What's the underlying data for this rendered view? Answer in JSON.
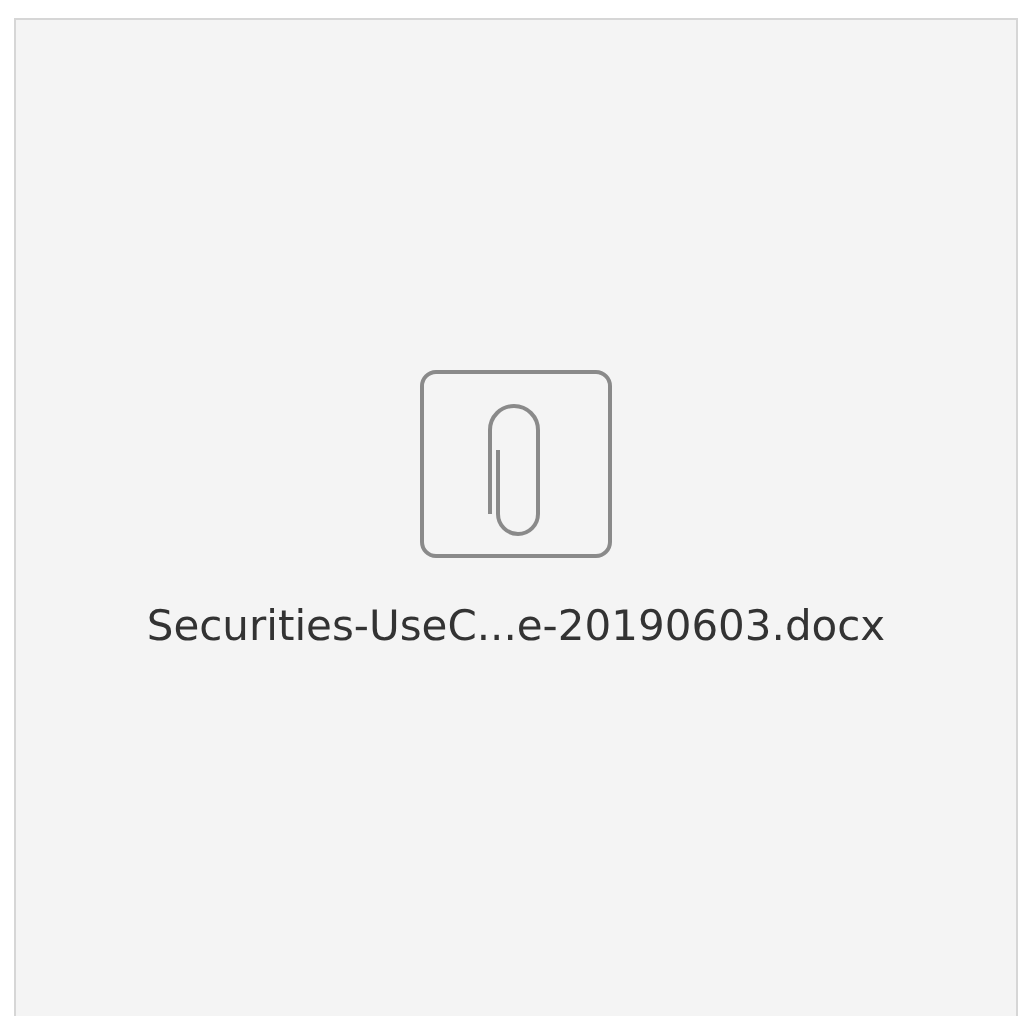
{
  "attachment": {
    "file_name": "Securities-UseC...e-20190603.docx"
  }
}
